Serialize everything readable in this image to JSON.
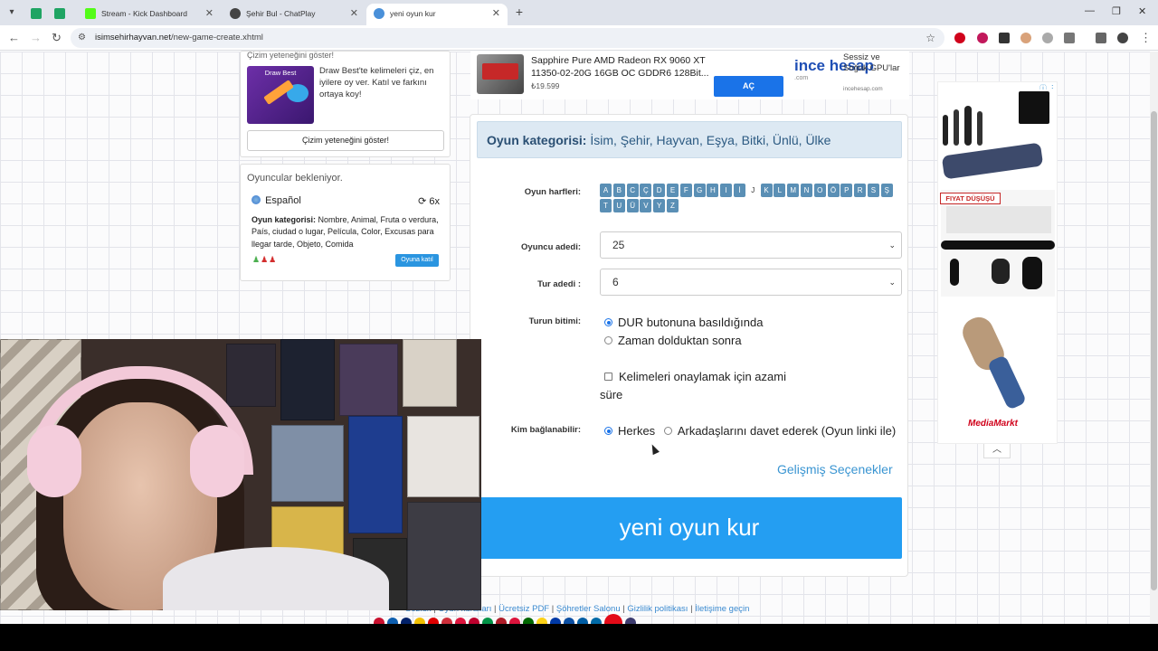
{
  "browser": {
    "tabs": [
      {
        "label": "",
        "icon": "sheets-icon",
        "color": "#1fa463"
      },
      {
        "label": "",
        "icon": "sheets-icon",
        "color": "#1fa463"
      },
      {
        "label": "Stream - Kick Dashboard",
        "icon": "kick-icon",
        "color": "#53fc18"
      },
      {
        "label": "Şehir Bul - ChatPlay",
        "icon": "chatplay-icon",
        "color": "#444444"
      },
      {
        "label": "yeni oyun kur",
        "icon": "site-icon",
        "color": "#4a90d9"
      }
    ],
    "url_domain": "isimsehirhayvan.net",
    "url_path": "/new-game-create.xhtml"
  },
  "left": {
    "draw_caption": "Çizim yeteneğini göster!",
    "draw_thumb_title": "Draw Best",
    "draw_description": "Draw Best'te kelimeleri çiz, en iyilere oy ver. Katıl ve farkını ortaya koy!",
    "draw_button": "Çizim yeteneğini göster!",
    "players_waiting": "Oyuncular bekleniyor.",
    "room_language": "Español",
    "room_rounds": "6x",
    "room_category_label": "Oyun kategorisi:",
    "room_categories": "Nombre, Animal, Fruta o verdura, País, ciudad o lugar, Película, Color, Excusas para llegar tarde, Objeto, Comida",
    "join_button": "Oyuna katıl"
  },
  "ad_top": {
    "title": "Sapphire Pure AMD Radeon RX 9060 XT 11350-02-20G 16GB OC GDDR6 128Bit...",
    "price": "₺19.599",
    "button": "AÇ",
    "brand": "ince hesap",
    "brand_sub": ".com",
    "side_text": "Sessiz ve Soğuk GPU'lar",
    "side_url": "incehesap.com"
  },
  "form": {
    "category_label": "Oyun kategorisi:",
    "category_value": "İsim, Şehir, Hayvan, Eşya, Bitki, Ünlü, Ülke",
    "letters_label": "Oyun harfleri:",
    "letters": [
      "A",
      "B",
      "C",
      "Ç",
      "D",
      "E",
      "F",
      "G",
      "H",
      "I",
      "İ",
      "J",
      "K",
      "L",
      "M",
      "N",
      "O",
      "Ö",
      "P",
      "R",
      "S",
      "Ş",
      "T",
      "U",
      "Ü",
      "V",
      "Y",
      "Z"
    ],
    "letters_off": [
      "J"
    ],
    "players_label": "Oyuncu adedi:",
    "players_value": "25",
    "rounds_label": "Tur adedi :",
    "rounds_value": "6",
    "round_end_label": "Turun bitimi:",
    "round_end_opt1": "DUR butonuna basıldığında",
    "round_end_opt2": "Zaman dolduktan sonra",
    "confirm_check": "Kelimeleri onaylamak için azami süre",
    "who_label": "Kim bağlanabilir:",
    "who_opt1": "Herkes",
    "who_opt2": "Arkadaşlarını davet ederek (Oyun linki ile)",
    "advanced_link": "Gelişmiş Seçenekler",
    "create_button": "yeni oyun kur"
  },
  "ad_right": {
    "badge": "FIYAT DÜŞÜŞÜ",
    "brand": "MediaMarkt"
  },
  "footer": {
    "links": [
      "Sözlük",
      "Oyun kuralları",
      "Ücretsiz PDF",
      "Şöhretler Salonu",
      "Gizlilik politikası",
      "İletişime geçin"
    ]
  }
}
